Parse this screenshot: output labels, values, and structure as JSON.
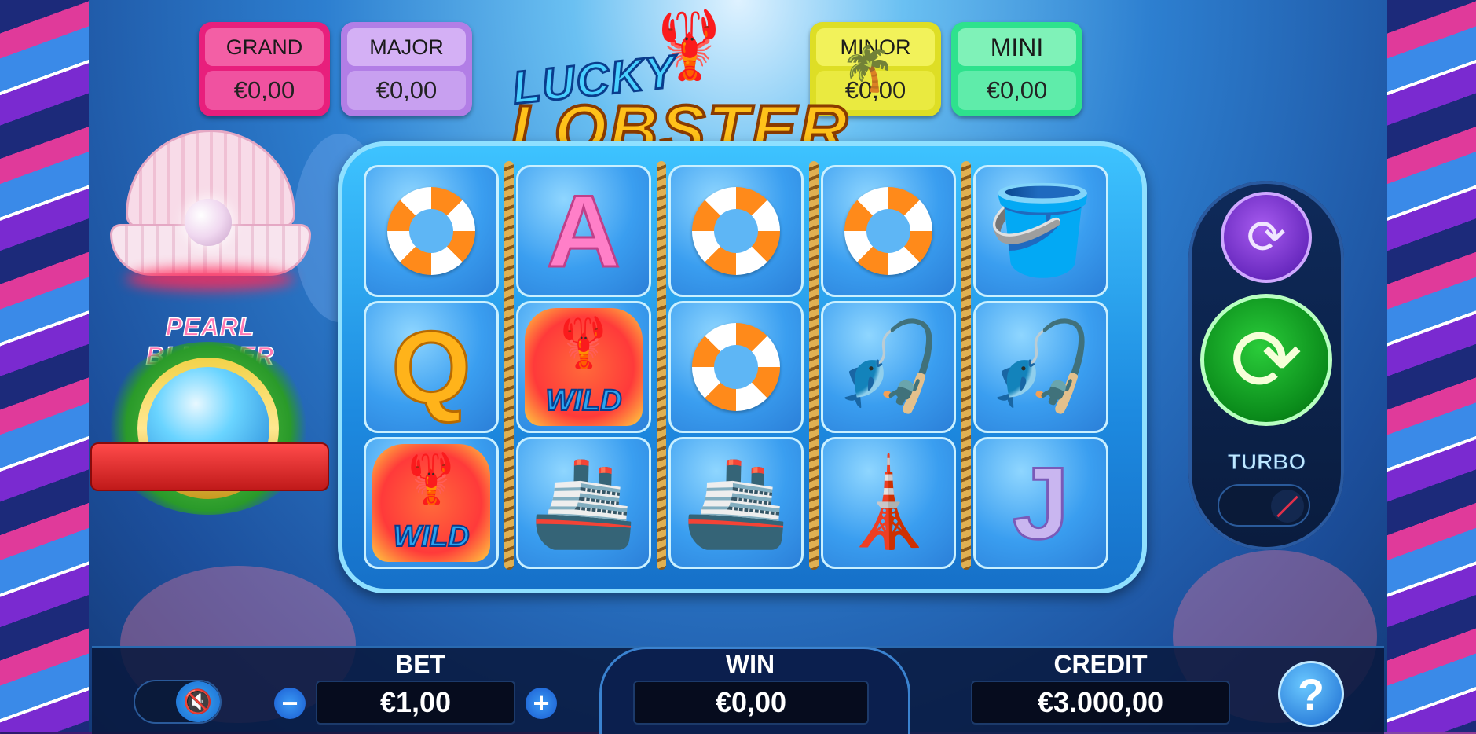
{
  "jackpots": {
    "grand": {
      "label": "GRAND",
      "value": "€0,00"
    },
    "major": {
      "label": "MAJOR",
      "value": "€0,00"
    },
    "minor": {
      "label": "MINOR",
      "value": "€0,00"
    },
    "mini": {
      "label": "MINI",
      "value": "€0,00"
    }
  },
  "logo": {
    "line1": "LUCKY",
    "line2": "LOBSTER"
  },
  "pearl_feature": {
    "title": "PEARL BLUNDER"
  },
  "reels": [
    [
      "life-ring",
      "letter-a",
      "life-ring",
      "life-ring",
      "fish-bucket"
    ],
    [
      "letter-q",
      "wild",
      "life-ring",
      "fishing-rod",
      "fishing-rod"
    ],
    [
      "wild",
      "fishing-boat",
      "fishing-boat",
      "lighthouse",
      "letter-j"
    ]
  ],
  "symbols": {
    "letter_a": "A",
    "letter_q": "Q",
    "letter_j": "J",
    "wild": "WILD",
    "fishing_boat": "🚢",
    "fishing_rod": "🎣",
    "fish_bucket": "🪣",
    "lighthouse": "🗼",
    "lobster": "🦞",
    "palm": "🌴"
  },
  "controls": {
    "autoplay_icon": "⟳",
    "spin_icon": "⟳",
    "turbo_label": "TURBO",
    "turbo_on": false
  },
  "bottom_bar": {
    "bet_label": "BET",
    "bet_value": "€1,00",
    "bet_minus": "−",
    "bet_plus": "+",
    "win_label": "WIN",
    "win_value": "€0,00",
    "credit_label": "CREDIT",
    "credit_value": "€3.000,00",
    "help_label": "?",
    "sound_icon": "🔇",
    "sound_on": false
  },
  "colors": {
    "grand": "#e81f7c",
    "major": "#b27ee6",
    "minor": "#dede25",
    "mini": "#2ee28d",
    "spin": "#0a8a1a",
    "autoplay": "#6a2ac0"
  }
}
